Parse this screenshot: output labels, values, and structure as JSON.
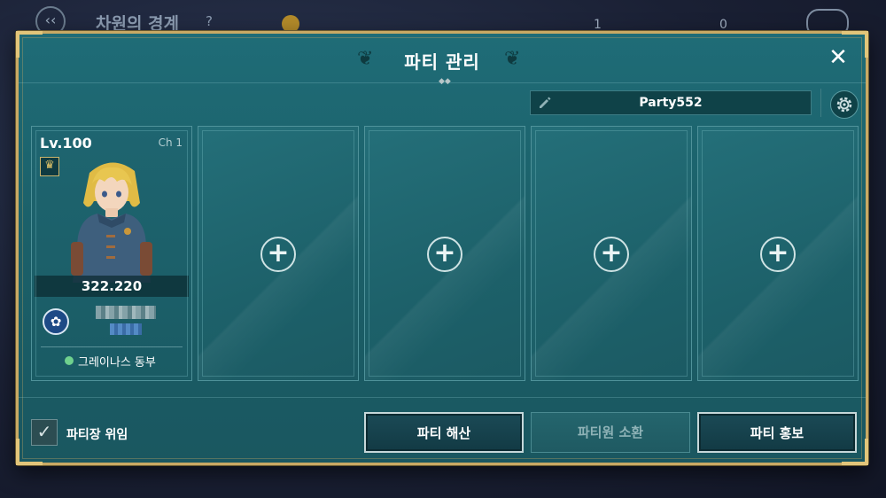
{
  "background": {
    "title": "차원의 경계",
    "help": "?",
    "counter_a": "1",
    "counter_b": "0"
  },
  "modal": {
    "title": "파티 관리",
    "close_icon": "close-icon",
    "party_name": "Party552",
    "settings_icon": "gear-icon"
  },
  "members": [
    {
      "level": "Lv.100",
      "channel": "Ch 1",
      "power": "322.220",
      "location": "그레이나스 동부",
      "is_leader": true,
      "status_color": "#6fd18e"
    }
  ],
  "empty_slots": [
    "+",
    "+",
    "+",
    "+"
  ],
  "footer": {
    "checkbox_label": "파티장 위임",
    "checkbox_checked": true,
    "buttons": [
      {
        "label": "파티 해산",
        "enabled": true
      },
      {
        "label": "파티원 소환",
        "enabled": false
      },
      {
        "label": "파티 홍보",
        "enabled": true
      }
    ]
  },
  "colors": {
    "frame_gold": "#c9a964",
    "panel_teal": "#1d626b",
    "online_green": "#6fd18e"
  }
}
